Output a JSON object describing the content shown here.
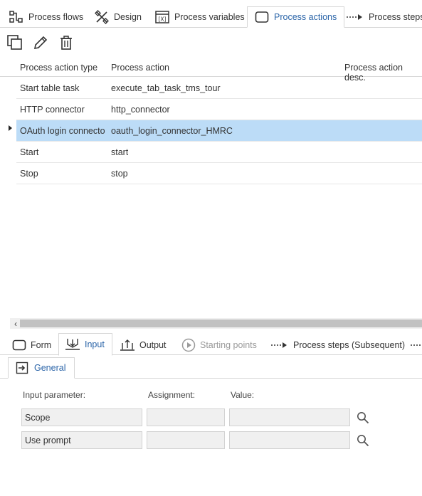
{
  "top_tabs": [
    {
      "label": "Process flows",
      "icon": "process-flows-icon"
    },
    {
      "label": "Design",
      "icon": "design-icon"
    },
    {
      "label": "Process variables",
      "icon": "process-variables-icon"
    },
    {
      "label": "Process actions",
      "icon": "process-actions-icon",
      "active": true
    },
    {
      "label": "Process steps",
      "icon": "process-steps-icon"
    }
  ],
  "toolbar": {
    "copy_icon": "copy-icon",
    "edit_icon": "pencil-icon",
    "delete_icon": "trash-icon"
  },
  "grid": {
    "columns": [
      "Process action type",
      "Process action",
      "Process action desc."
    ],
    "rows": [
      {
        "type": "Start table task",
        "action": "execute_tab_task_tms_tour",
        "desc": ""
      },
      {
        "type": "HTTP connector",
        "action": "http_connector",
        "desc": ""
      },
      {
        "type": "OAuth login connecto",
        "action": "oauth_login_connector_HMRC",
        "desc": "",
        "selected": true
      },
      {
        "type": "Start",
        "action": "start",
        "desc": ""
      },
      {
        "type": "Stop",
        "action": "stop",
        "desc": ""
      }
    ]
  },
  "bottom_tabs": [
    {
      "label": "Form",
      "icon": "form-icon"
    },
    {
      "label": "Input",
      "icon": "input-icon",
      "active": true
    },
    {
      "label": "Output",
      "icon": "output-icon"
    },
    {
      "label": "Starting points",
      "icon": "play-circle-icon",
      "disabled": true
    },
    {
      "label": "Process steps (Subsequent)",
      "icon": "process-steps-icon"
    }
  ],
  "subtab": {
    "label": "General",
    "icon": "enter-icon"
  },
  "params": {
    "headers": {
      "input": "Input parameter:",
      "assignment": "Assignment:",
      "value": "Value:"
    },
    "rows": [
      {
        "name": "Scope",
        "assignment": "",
        "value": ""
      },
      {
        "name": "Use prompt",
        "assignment": "",
        "value": ""
      }
    ]
  },
  "colors": {
    "accent": "#2a64a8",
    "selection": "#bcdcf7"
  }
}
